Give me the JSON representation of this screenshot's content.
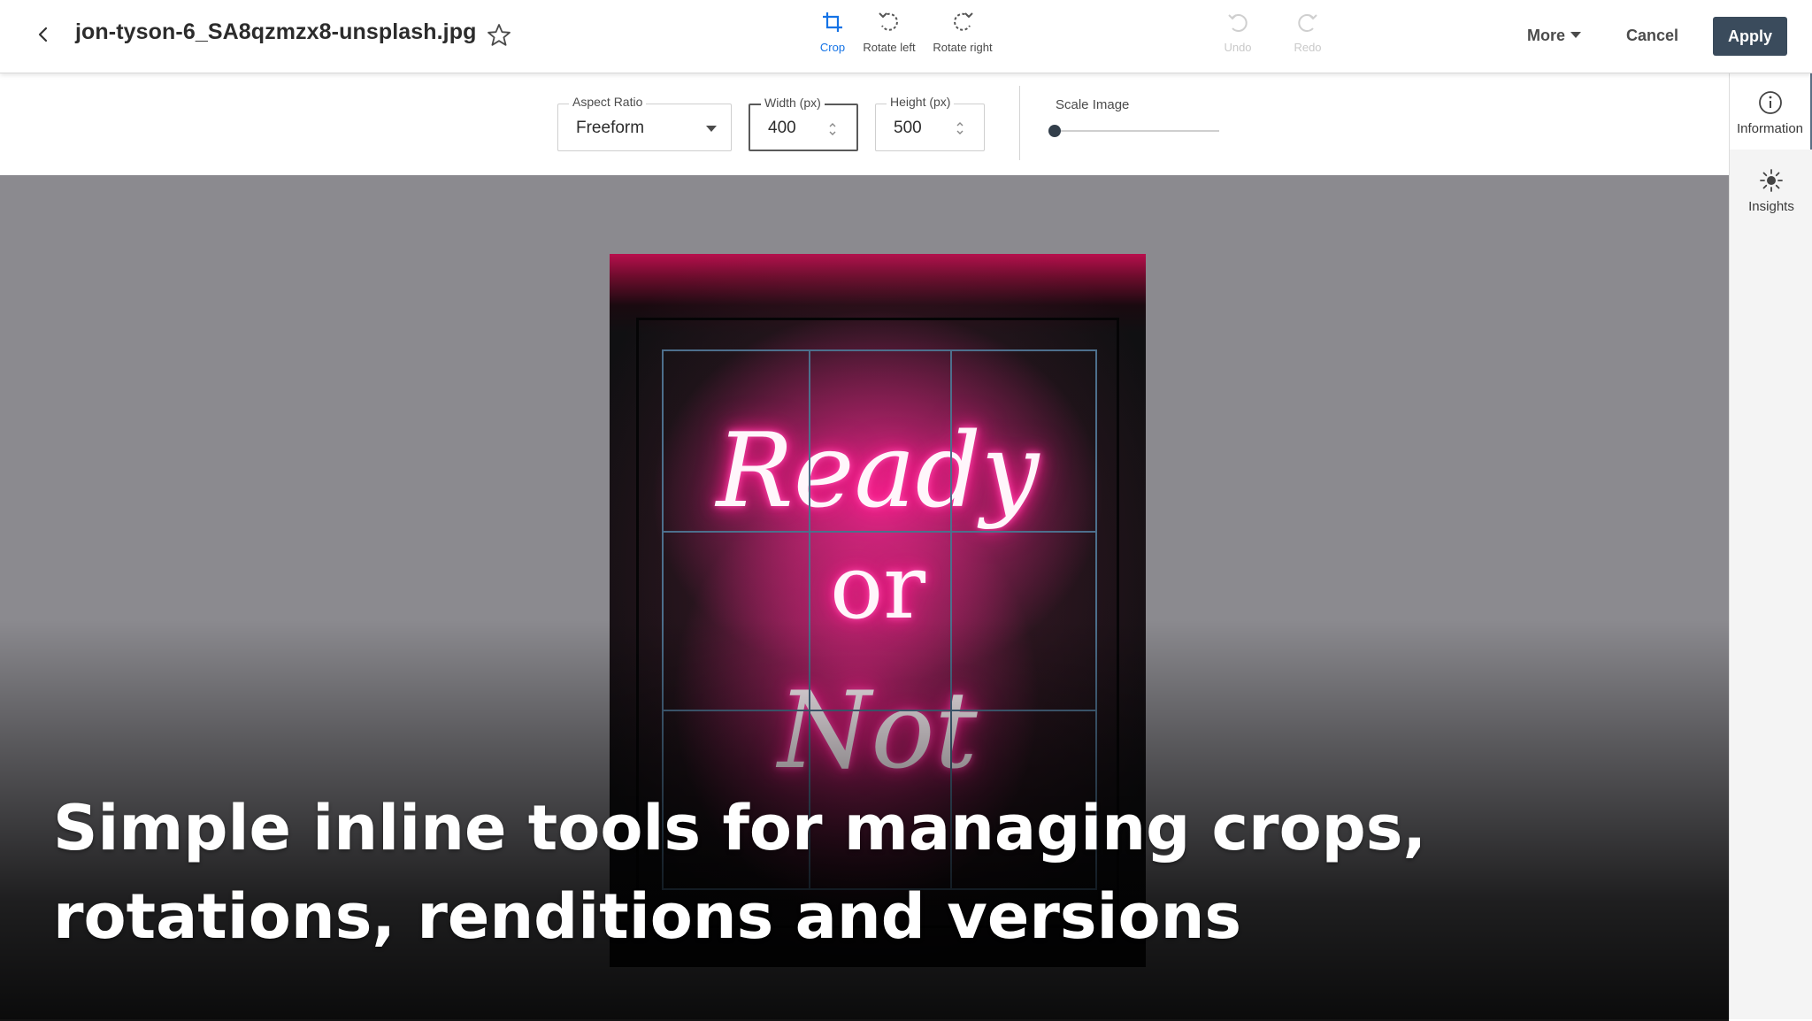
{
  "header": {
    "back_icon": "chevron-left-icon",
    "filename": "jon-tyson-6_SA8qzmzx8-unsplash.jpg",
    "favorite_icon": "star-outline-icon",
    "tools": [
      {
        "label": "Crop",
        "icon": "crop-icon",
        "state": "active"
      },
      {
        "label": "Rotate left",
        "icon": "rotate-left-icon",
        "state": "enabled"
      },
      {
        "label": "Rotate right",
        "icon": "rotate-right-icon",
        "state": "enabled"
      },
      {
        "label": "Undo",
        "icon": "undo-icon",
        "state": "disabled"
      },
      {
        "label": "Redo",
        "icon": "redo-icon",
        "state": "disabled"
      }
    ],
    "more_label": "More",
    "cancel_label": "Cancel",
    "apply_label": "Apply"
  },
  "crop_options": {
    "aspect_ratio": {
      "label": "Aspect Ratio",
      "value": "Freeform"
    },
    "width": {
      "label": "Width (px)",
      "value": "400"
    },
    "height": {
      "label": "Height (px)",
      "value": "500"
    },
    "scale": {
      "label": "Scale Image",
      "value_fraction": 0.0
    }
  },
  "rail": {
    "items": [
      {
        "label": "Information",
        "icon": "info-icon",
        "active": true
      },
      {
        "label": "Insights",
        "icon": "sun-icon",
        "active": false
      }
    ]
  },
  "photo": {
    "sign_lines": [
      "Ready",
      "or",
      "Not"
    ]
  },
  "caption": {
    "text": "Simple inline tools for managing crops, rotations, renditions and versions"
  },
  "colors": {
    "accent": "#1473e6",
    "apply_bg": "#3a4b5c",
    "canvas_bg": "#8b8a8f",
    "crop_grid": "#4d6f8c",
    "neon": "#ff1a8c"
  }
}
